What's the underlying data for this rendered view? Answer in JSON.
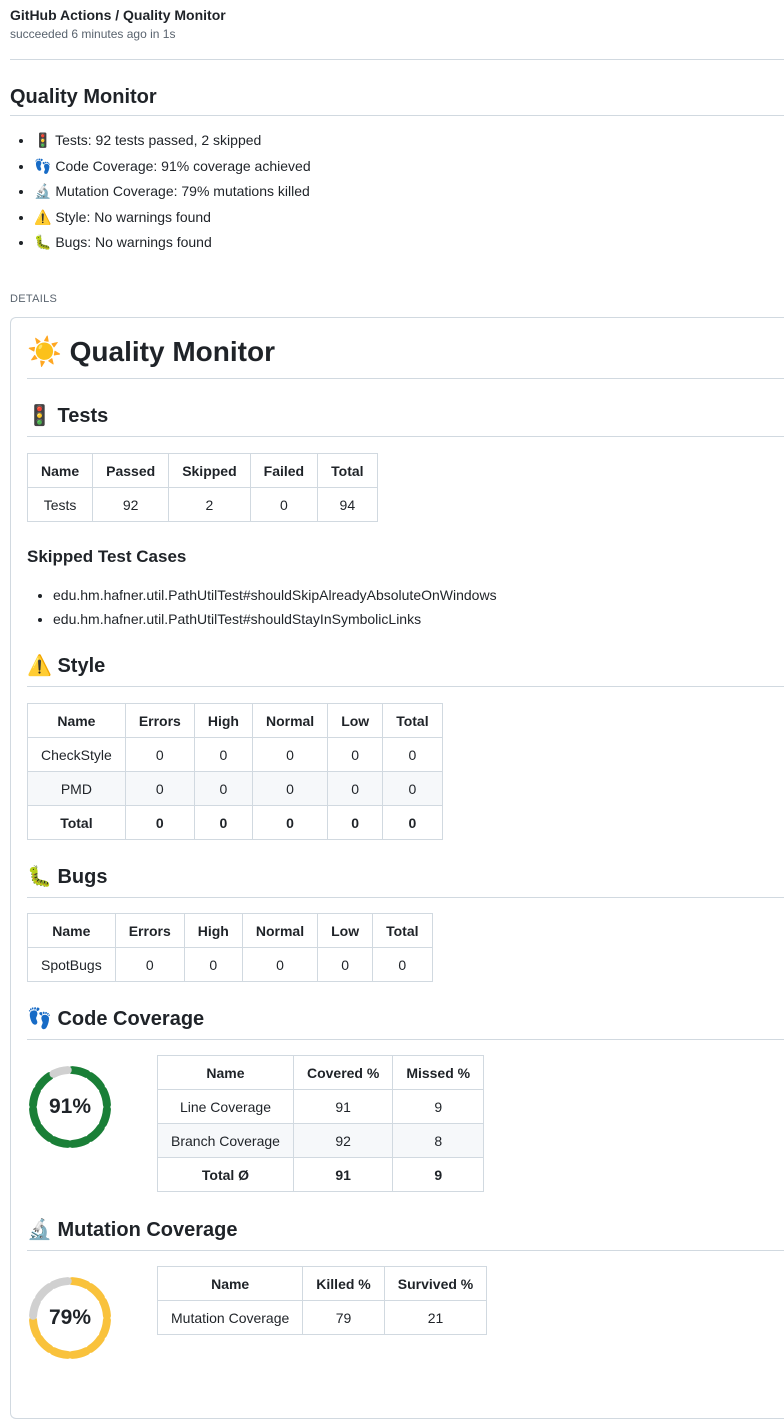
{
  "header": {
    "title": "GitHub Actions / Quality Monitor",
    "subtitle": "succeeded 6 minutes ago in 1s"
  },
  "summary": {
    "title": "Quality Monitor",
    "items": [
      {
        "icon": "🚦",
        "icon_name": "traffic-light-icon",
        "text": "Tests: 92 tests passed, 2 skipped"
      },
      {
        "icon": "👣",
        "icon_name": "footprints-icon",
        "text": "Code Coverage: 91% coverage achieved"
      },
      {
        "icon": "🔬",
        "icon_name": "microscope-icon",
        "text": "Mutation Coverage: 79% mutations killed"
      },
      {
        "icon": "⚠️",
        "icon_name": "warning-icon",
        "text": "Style: No warnings found"
      },
      {
        "icon": "🐛",
        "icon_name": "bug-icon",
        "text": "Bugs: No warnings found"
      }
    ]
  },
  "details_label": "DETAILS",
  "report": {
    "title_icon": "☀️",
    "title": "Quality Monitor",
    "tests": {
      "icon": "🚦",
      "heading": "Tests",
      "headers": [
        "Name",
        "Passed",
        "Skipped",
        "Failed",
        "Total"
      ],
      "rows": [
        [
          "Tests",
          "92",
          "2",
          "0",
          "94"
        ]
      ],
      "skipped_heading": "Skipped Test Cases",
      "skipped": [
        "edu.hm.hafner.util.PathUtilTest#shouldSkipAlreadyAbsoluteOnWindows",
        "edu.hm.hafner.util.PathUtilTest#shouldStayInSymbolicLinks"
      ]
    },
    "style": {
      "icon": "⚠️",
      "heading": "Style",
      "headers": [
        "Name",
        "Errors",
        "High",
        "Normal",
        "Low",
        "Total"
      ],
      "rows": [
        [
          "CheckStyle",
          "0",
          "0",
          "0",
          "0",
          "0"
        ],
        [
          "PMD",
          "0",
          "0",
          "0",
          "0",
          "0"
        ],
        [
          "Total",
          "0",
          "0",
          "0",
          "0",
          "0"
        ]
      ]
    },
    "bugs": {
      "icon": "🐛",
      "heading": "Bugs",
      "headers": [
        "Name",
        "Errors",
        "High",
        "Normal",
        "Low",
        "Total"
      ],
      "rows": [
        [
          "SpotBugs",
          "0",
          "0",
          "0",
          "0",
          "0"
        ]
      ]
    },
    "code_coverage": {
      "icon": "👣",
      "heading": "Code Coverage",
      "percent": 91,
      "percent_label": "91%",
      "color": "#1a7f37",
      "headers": [
        "Name",
        "Covered %",
        "Missed %"
      ],
      "rows": [
        [
          "Line Coverage",
          "91",
          "9"
        ],
        [
          "Branch Coverage",
          "92",
          "8"
        ],
        [
          "Total Ø",
          "91",
          "9"
        ]
      ]
    },
    "mutation_coverage": {
      "icon": "🔬",
      "heading": "Mutation Coverage",
      "percent": 79,
      "percent_label": "79%",
      "color": "#f9c23c",
      "headers": [
        "Name",
        "Killed %",
        "Survived %"
      ],
      "rows": [
        [
          "Mutation Coverage",
          "79",
          "21"
        ]
      ]
    }
  }
}
